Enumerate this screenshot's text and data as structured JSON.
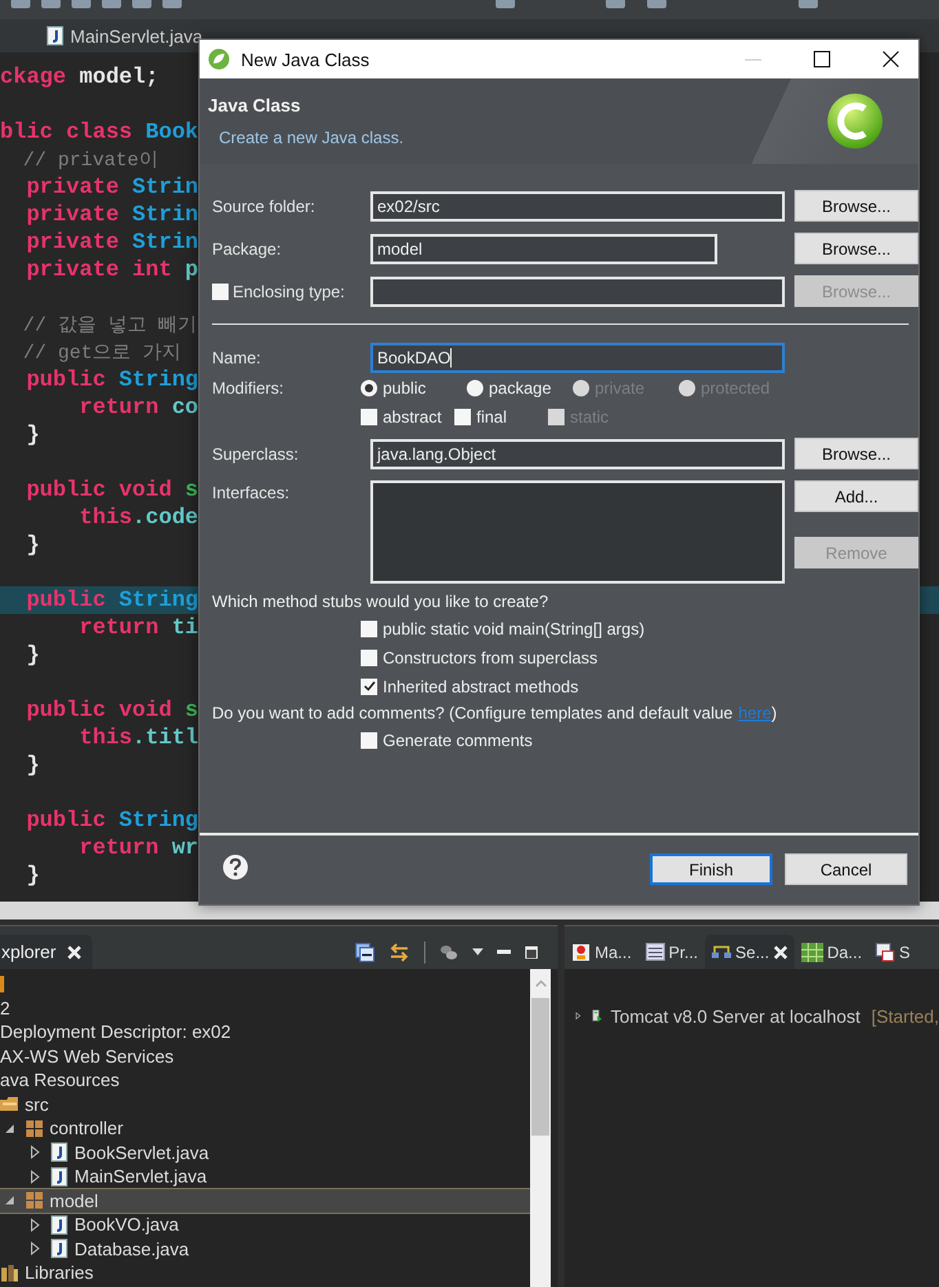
{
  "editor_tabs": [
    {
      "label": "MainServlet.java",
      "selected": false
    }
  ],
  "editor": {
    "lines": [
      {
        "current": false,
        "tokens": [
          {
            "kind": "keyword",
            "text": "ckage"
          },
          {
            "kind": "plain",
            "text": " model;"
          }
        ]
      },
      {
        "current": false,
        "kind": "blank"
      },
      {
        "current": false,
        "tokens": [
          {
            "kind": "keyword",
            "text": "blic class"
          },
          {
            "kind": "type",
            "text": " Book"
          }
        ]
      },
      {
        "current": false,
        "tokens": [
          {
            "kind": "comment",
            "text": "  // private이"
          }
        ]
      },
      {
        "current": false,
        "tokens": [
          {
            "kind": "keyword",
            "text": "  private"
          },
          {
            "kind": "type",
            "text": " Strin"
          }
        ]
      },
      {
        "current": false,
        "tokens": [
          {
            "kind": "keyword",
            "text": "  private"
          },
          {
            "kind": "type",
            "text": " Strin"
          }
        ]
      },
      {
        "current": false,
        "tokens": [
          {
            "kind": "keyword",
            "text": "  private"
          },
          {
            "kind": "type",
            "text": " Strin"
          }
        ]
      },
      {
        "current": false,
        "tokens": [
          {
            "kind": "keyword",
            "text": "  private int"
          },
          {
            "kind": "field",
            "text": " p"
          }
        ]
      },
      {
        "current": false,
        "kind": "blank"
      },
      {
        "current": false,
        "tokens": [
          {
            "kind": "comment",
            "text": "  // 값을 넣고 빼기"
          }
        ]
      },
      {
        "current": false,
        "tokens": [
          {
            "kind": "comment",
            "text": "  // get으로 가지"
          }
        ]
      },
      {
        "current": false,
        "tokens": [
          {
            "kind": "keyword",
            "text": "  public"
          },
          {
            "kind": "type",
            "text": " String"
          }
        ]
      },
      {
        "current": false,
        "tokens": [
          {
            "kind": "keyword",
            "text": "      return"
          },
          {
            "kind": "field",
            "text": " co"
          }
        ]
      },
      {
        "current": false,
        "tokens": [
          {
            "kind": "plain",
            "text": "  }"
          }
        ]
      },
      {
        "current": false,
        "kind": "blank"
      },
      {
        "current": false,
        "tokens": [
          {
            "kind": "keyword",
            "text": "  public void"
          },
          {
            "kind": "method",
            "text": " s"
          }
        ]
      },
      {
        "current": false,
        "tokens": [
          {
            "kind": "keyword",
            "text": "      this"
          },
          {
            "kind": "field",
            "text": ".code"
          }
        ]
      },
      {
        "current": false,
        "tokens": [
          {
            "kind": "plain",
            "text": "  }"
          }
        ]
      },
      {
        "current": false,
        "kind": "blank"
      },
      {
        "current": true,
        "tokens": [
          {
            "kind": "keyword",
            "text": "  public"
          },
          {
            "kind": "type",
            "text": " String"
          }
        ]
      },
      {
        "current": false,
        "tokens": [
          {
            "kind": "keyword",
            "text": "      return"
          },
          {
            "kind": "field",
            "text": " ti"
          }
        ]
      },
      {
        "current": false,
        "tokens": [
          {
            "kind": "plain",
            "text": "  }"
          }
        ]
      },
      {
        "current": false,
        "kind": "blank"
      },
      {
        "current": false,
        "tokens": [
          {
            "kind": "keyword",
            "text": "  public void"
          },
          {
            "kind": "method",
            "text": " s"
          }
        ]
      },
      {
        "current": false,
        "tokens": [
          {
            "kind": "keyword",
            "text": "      this"
          },
          {
            "kind": "field",
            "text": ".titl"
          }
        ]
      },
      {
        "current": false,
        "tokens": [
          {
            "kind": "plain",
            "text": "  }"
          }
        ]
      },
      {
        "current": false,
        "kind": "blank"
      },
      {
        "current": false,
        "tokens": [
          {
            "kind": "keyword",
            "text": "  public"
          },
          {
            "kind": "type",
            "text": " String"
          }
        ]
      },
      {
        "current": false,
        "tokens": [
          {
            "kind": "keyword",
            "text": "      return"
          },
          {
            "kind": "field",
            "text": " wr"
          }
        ]
      },
      {
        "current": false,
        "tokens": [
          {
            "kind": "plain",
            "text": "  }"
          }
        ]
      }
    ]
  },
  "dialog": {
    "title": "New Java Class",
    "heading": "Java Class",
    "description": "Create a new Java class.",
    "source_folder": {
      "label": "Source folder:",
      "value": "ex02/src",
      "focused": false,
      "button": {
        "label": "Browse...",
        "disabled": false
      }
    },
    "package": {
      "label": "Package:",
      "value": "model",
      "focused": false,
      "button": {
        "label": "Browse...",
        "disabled": false
      }
    },
    "enclosing_type": {
      "label": "Enclosing type:",
      "checked": false,
      "focused": false,
      "button": {
        "label": "Browse...",
        "disabled": true
      }
    },
    "name": {
      "label": "Name:",
      "value": "BookDAO",
      "focused": true
    },
    "modifiers": {
      "label": "Modifiers:",
      "access": [
        {
          "label": "public",
          "selected": true,
          "disabled": false
        },
        {
          "label": "package",
          "selected": false,
          "disabled": false
        },
        {
          "label": "private",
          "selected": false,
          "disabled": true
        },
        {
          "label": "protected",
          "selected": false,
          "disabled": true
        }
      ],
      "flags": [
        {
          "label": "abstract",
          "checked": false,
          "disabled": false
        },
        {
          "label": "final",
          "checked": false,
          "disabled": false
        },
        {
          "label": "static",
          "checked": false,
          "disabled": true
        }
      ]
    },
    "superclass": {
      "label": "Superclass:",
      "value": "java.lang.Object",
      "focused": false,
      "button": {
        "label": "Browse...",
        "disabled": false
      }
    },
    "interfaces": {
      "label": "Interfaces:",
      "buttons": [
        {
          "label": "Add...",
          "disabled": false
        },
        {
          "label": "Remove",
          "disabled": true
        }
      ]
    },
    "stubs": {
      "prompt": "Which method stubs would you like to create?",
      "options": [
        {
          "label": "public static void main(String[] args)",
          "checked": false
        },
        {
          "label": "Constructors from superclass",
          "checked": false
        },
        {
          "label": "Inherited abstract methods",
          "checked": true
        }
      ]
    },
    "comments": {
      "prompt_before": "Do you want to add comments? (Configure templates and default value",
      "link": "here",
      "prompt_after": ")",
      "options": [
        {
          "label": "Generate comments",
          "checked": false
        }
      ]
    },
    "buttons": [
      {
        "label": "Finish",
        "default": true
      },
      {
        "label": "Cancel",
        "default": false
      }
    ]
  },
  "explorer": {
    "tab": "xplorer",
    "tree": [
      {
        "label": "2",
        "selected": false
      },
      {
        "label": "Deployment Descriptor: ex02",
        "selected": false
      },
      {
        "label": "AX-WS Web Services",
        "selected": false
      },
      {
        "label": "ava Resources",
        "selected": false,
        "children": [
          {
            "label": "src",
            "kind": "source_folder",
            "selected": false,
            "children": [
              {
                "label": "controller",
                "kind": "package",
                "selected": false,
                "expanded": true,
                "children": [
                  {
                    "label": "BookServlet.java",
                    "kind": "java_file",
                    "selected": false,
                    "expanded": false
                  },
                  {
                    "label": "MainServlet.java",
                    "kind": "java_file",
                    "selected": false,
                    "expanded": false
                  }
                ]
              },
              {
                "label": "model",
                "kind": "package",
                "selected": true,
                "expanded": true,
                "children": [
                  {
                    "label": "BookVO.java",
                    "kind": "java_file",
                    "selected": false,
                    "expanded": false
                  },
                  {
                    "label": "Database.java",
                    "kind": "java_file",
                    "selected": false,
                    "expanded": false
                  }
                ]
              }
            ]
          },
          {
            "label": "Libraries",
            "kind": "library",
            "selected": false
          }
        ]
      }
    ]
  },
  "servers_panel": {
    "tabs": [
      {
        "label": "Ma...",
        "kind": "markers",
        "selected": false
      },
      {
        "label": "Pr...",
        "kind": "properties",
        "selected": false
      },
      {
        "label": "Se...",
        "kind": "servers",
        "selected": true
      },
      {
        "label": "Da...",
        "kind": "data",
        "selected": false
      },
      {
        "label": "S",
        "kind": "snippets",
        "selected": false
      }
    ],
    "servers": [
      {
        "name": "Tomcat v8.0 Server at localhost",
        "status": "[Started,",
        "expanded": false
      }
    ]
  }
}
